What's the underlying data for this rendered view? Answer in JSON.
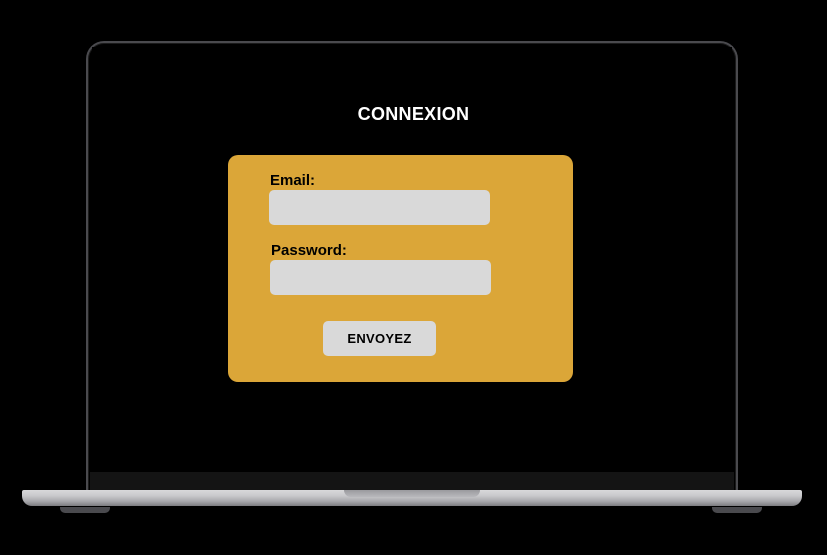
{
  "page": {
    "title": "CONNEXION"
  },
  "form": {
    "email_label": "Email:",
    "email_value": "",
    "password_label": "Password:",
    "password_value": "",
    "submit_label": "ENVOYEZ"
  },
  "colors": {
    "background": "#000000",
    "card": "#dba638",
    "input": "#d9d9d9",
    "button": "#d9d9d9",
    "title_text": "#ffffff",
    "label_text": "#000000"
  }
}
